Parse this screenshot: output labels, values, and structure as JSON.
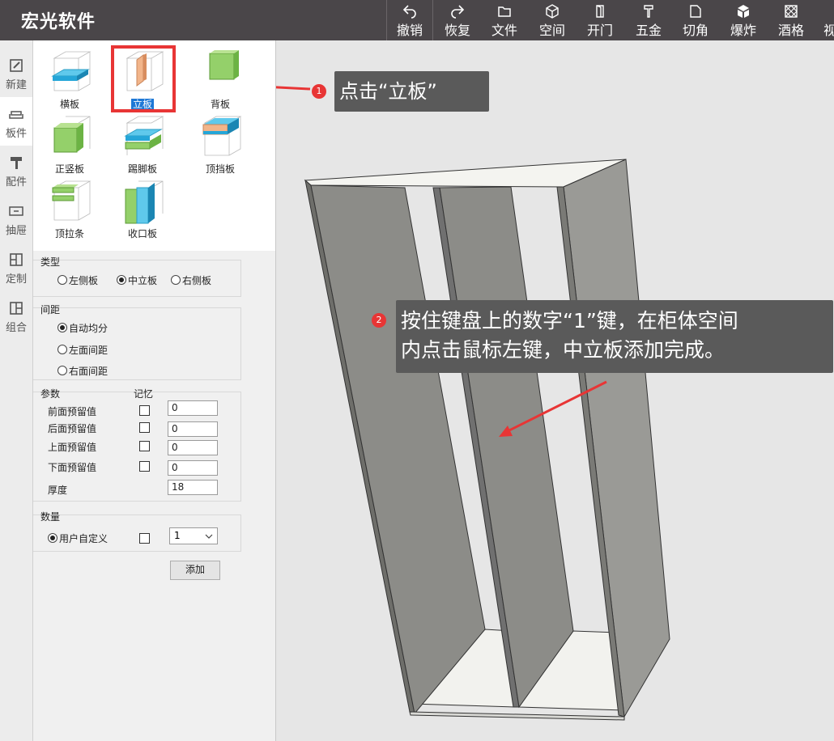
{
  "app": {
    "title": "宏光软件"
  },
  "toolbar": {
    "buttons": [
      {
        "label": "撤销",
        "icon": "undo-icon"
      },
      {
        "label": "恢复",
        "icon": "redo-icon"
      },
      {
        "label": "文件",
        "icon": "folder-icon"
      },
      {
        "label": "空间",
        "icon": "cube-icon"
      },
      {
        "label": "开门",
        "icon": "door-icon"
      },
      {
        "label": "五金",
        "icon": "hardware-icon"
      },
      {
        "label": "切角",
        "icon": "corner-cut-icon"
      },
      {
        "label": "爆炸",
        "icon": "explode-icon"
      },
      {
        "label": "酒格",
        "icon": "wine-grid-icon"
      },
      {
        "label": "视",
        "icon": "view-icon"
      }
    ]
  },
  "rail": {
    "items": [
      {
        "label": "新建",
        "icon": "edit-icon"
      },
      {
        "label": "板件",
        "icon": "sofa-icon"
      },
      {
        "label": "配件",
        "icon": "roller-icon"
      },
      {
        "label": "抽屉",
        "icon": "drawer-icon"
      },
      {
        "label": "定制",
        "icon": "custom-icon"
      },
      {
        "label": "组合",
        "icon": "combine-icon"
      }
    ],
    "active_index": 1
  },
  "gallery": {
    "items": [
      {
        "label": "横板",
        "icon": "horizontal-board-icon"
      },
      {
        "label": "立板",
        "icon": "vertical-board-icon"
      },
      {
        "label": "背板",
        "icon": "back-board-icon"
      },
      {
        "label": "正竖板",
        "icon": "front-vertical-board-icon"
      },
      {
        "label": "踢脚板",
        "icon": "kick-board-icon"
      },
      {
        "label": "顶挡板",
        "icon": "top-baffle-icon"
      },
      {
        "label": "顶拉条",
        "icon": "top-strip-icon"
      },
      {
        "label": "收口板",
        "icon": "closing-board-icon"
      }
    ],
    "selected_index": 1
  },
  "type_group": {
    "label": "类型",
    "options": [
      "左侧板",
      "中立板",
      "右侧板"
    ],
    "selected": "中立板"
  },
  "spacing_group": {
    "label": "间距",
    "options": [
      "自动均分",
      "左面间距",
      "右面间距"
    ],
    "selected": "自动均分"
  },
  "params_group": {
    "label": "参数",
    "memory_label": "记忆",
    "rows": [
      {
        "label": "前面预留值",
        "value": "0",
        "has_checkbox": true
      },
      {
        "label": "后面预留值",
        "value": "0",
        "has_checkbox": true
      },
      {
        "label": "上面预留值",
        "value": "0",
        "has_checkbox": true
      },
      {
        "label": "下面预留值",
        "value": "0",
        "has_checkbox": true
      },
      {
        "label": "厚度",
        "value": "18",
        "has_checkbox": false
      }
    ]
  },
  "qty_group": {
    "label": "数量",
    "option": "用户自定义",
    "select_value": "1"
  },
  "add_button": "添加",
  "annotations": {
    "step1": {
      "badge": "1",
      "text": "点击“立板”"
    },
    "step2": {
      "badge": "2",
      "line1": "按住键盘上的数字“1”键，在柜体空间",
      "line2": "内点击鼠标左键，中立板添加完成。"
    }
  },
  "colors": {
    "topbar": "#4a4649",
    "panel_face": "#8c8c88",
    "highlight": "#e83535",
    "selected_label": "#1e78d6"
  }
}
